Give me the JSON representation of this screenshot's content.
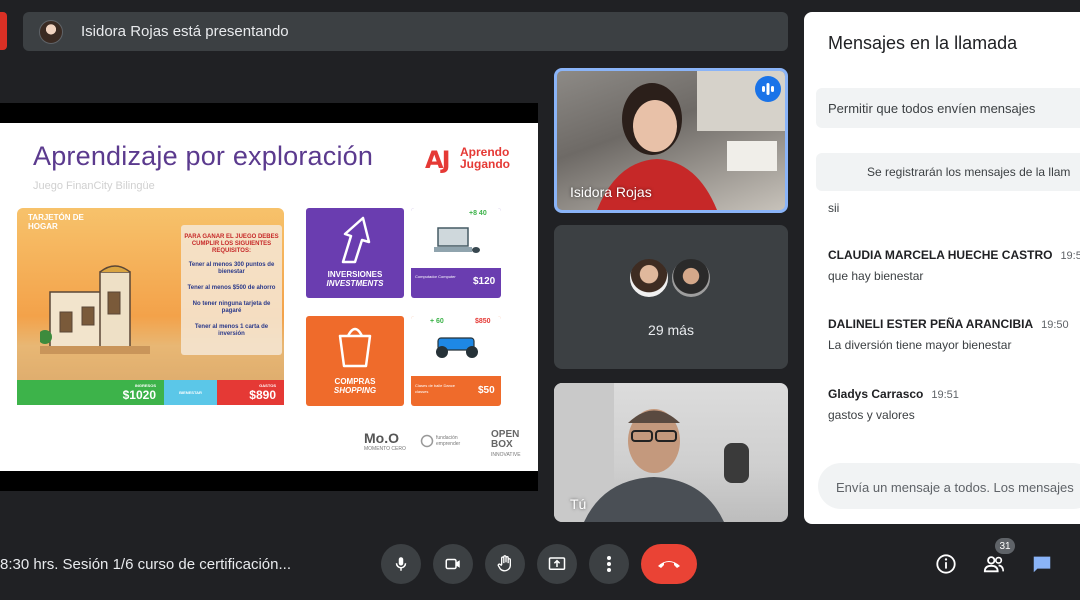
{
  "top_bar": {
    "presenting_text": "Isidora Rojas está presentando"
  },
  "slide": {
    "title": "Aprendizaje por exploración",
    "subtitle": "Juego FinanCity Bilingüe",
    "logo_mark": "AJ",
    "logo_line1": "Aprendo",
    "logo_line2": "Jugando",
    "home_card": {
      "label": "TARJETÓN DE HOGAR",
      "rules_heading": "PARA GANAR EL JUEGO DEBES CUMPLIR LOS SIGUIENTES REQUISITOS:",
      "rules": [
        "Tener al menos 300 puntos de bienestar",
        "Tener al menos $500 de ahorro",
        "No tener ninguna tarjeta de pagaré",
        "Tener al menos 1 carta de inversión"
      ],
      "bar": {
        "income_label": "INGRESOS",
        "income_value": "$1020",
        "wellbeing_label": "BIENESTAR",
        "expenses_label": "GASTOS",
        "expenses_value": "$890"
      }
    },
    "cards": {
      "investments_title": "INVERSIONES",
      "investments_sub": "INVESTMENTS",
      "computer_badge": "+8 40",
      "computer_name": "Computador Computer",
      "computer_price": "$120",
      "shopping_title": "COMPRAS",
      "shopping_sub": "SHOPPING",
      "dance_badge_green": "+ 60",
      "dance_badge_red": "$850",
      "dance_name": "Clases de baile Dance classes",
      "dance_price": "$50"
    },
    "sponsors": {
      "mo": "Mo.O",
      "mo_sub": "MOMENTO CERO",
      "fundacion": "fundación emprender",
      "openbox": "OPEN BOX",
      "openbox_sub": "INNOVATIVE"
    }
  },
  "tiles": {
    "presenter_name": "Isidora Rojas",
    "more_count": "29 más",
    "self_name": "Tú"
  },
  "chat": {
    "title": "Mensajes en la llamada",
    "toggle_label": "Permitir que todos envíen mensajes",
    "note": "Se registrarán los mensajes de la llam",
    "first_message": "sii",
    "messages": [
      {
        "sender": "CLAUDIA MARCELA HUECHE CASTRO",
        "time": "19:5",
        "text": "que hay bienestar"
      },
      {
        "sender": "DALINELI ESTER PEÑA ARANCIBIA",
        "time": "19:50",
        "text": "La diversión tiene mayor bienestar"
      },
      {
        "sender": "Gladys Carrasco",
        "time": "19:51",
        "text": "gastos y valores"
      }
    ],
    "input_placeholder": "Envía un mensaje a todos. Los mensajes"
  },
  "bottom_bar": {
    "meeting_title": "8:30 hrs. Sesión 1/6 curso de certificación...",
    "participants_count": "31"
  },
  "icons": {
    "mic": "mic-icon",
    "camera": "camera-icon",
    "hand": "raise-hand-icon",
    "present": "present-screen-icon",
    "more": "more-vert-icon",
    "end": "end-call-icon",
    "info": "info-icon",
    "people": "people-icon",
    "chat": "chat-icon"
  },
  "colors": {
    "accent": "#8ab4f8",
    "end_call": "#ea4335",
    "chat_icon": "#8ab4f8"
  }
}
